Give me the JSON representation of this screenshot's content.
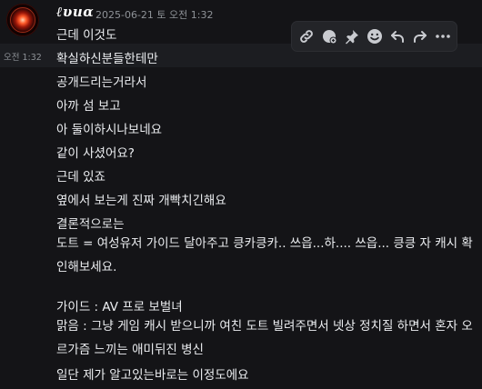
{
  "message": {
    "username": "ℓυиα",
    "timestamp": "2025-06-21 토 오전 1:32",
    "hover_time": "오전 1:32",
    "lines": [
      "근데 이것도",
      "확실하신분들한테만",
      "공개드리는거라서",
      "아까 섬 보고",
      "아 둘이하시나보네요",
      "같이 사셨어요?",
      "근데 있죠",
      "옆에서 보는게 진짜 개빡치긴해요",
      "결론적으로는",
      "도트 = 여성유저 가이드 달아주고 킁카킁카.. 쓰읍...하.... 쓰읍... 킁킁 자 캐시 확인해보세요.",
      "가이드 : AV 프로 보벌녀",
      "맑음 : 그냥 게임 캐시 받으니까 여친 도트 빌려주면서 넷상 정치질 하면서 혼자 오르가즘 느끼는 애미뒤진 병신",
      "일단 제가 알고있는바로는 이정도에요"
    ]
  },
  "toolbar": {
    "icons": [
      "link-icon",
      "thread-icon",
      "pin-icon",
      "emoji-icon",
      "reply-icon",
      "forward-icon",
      "more-icon"
    ]
  },
  "colors": {
    "background": "#141417",
    "hover_row": "#1c1d21",
    "toolbar_bg": "#232428",
    "text": "#eceef1",
    "muted": "#8e9297",
    "icon": "#c9cbd0"
  }
}
